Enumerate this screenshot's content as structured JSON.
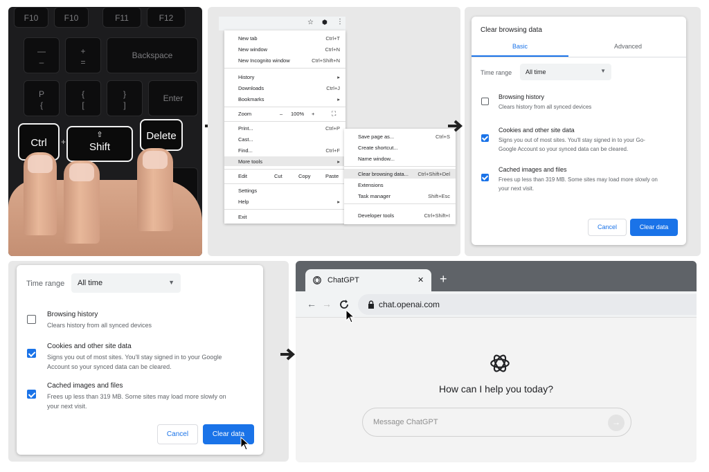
{
  "keyboard": {
    "f10a": "F10",
    "f10b": "F10",
    "f11": "F11",
    "f12": "F12",
    "minus_top": "—",
    "minus_bot": "–",
    "plus_top": "+",
    "plus_bot": "=",
    "backspace": "Backspace",
    "p_top": "P",
    "p_bot": "{",
    "bracket1_top": "{",
    "bracket1_bot": "[",
    "bracket2_top": "}",
    "bracket2_bot": "]",
    "enter": "Enter",
    "ctrl": "Ctrl",
    "shift": "Shift",
    "delete": "Delete",
    "plus_sign": "+"
  },
  "menu": {
    "items": [
      {
        "label": "New tab",
        "shortcut": "Ctrl+T"
      },
      {
        "label": "New window",
        "shortcut": "Ctrl+N"
      },
      {
        "label": "New Incognito window",
        "shortcut": "Ctrl+Shift+N"
      },
      {
        "label": "History",
        "shortcut": "▸"
      },
      {
        "label": "Downloads",
        "shortcut": "Ctrl+J"
      },
      {
        "label": "Bookmarks",
        "shortcut": "▸"
      },
      {
        "label": "Print...",
        "shortcut": "Ctrl+P"
      },
      {
        "label": "Cast...",
        "shortcut": ""
      },
      {
        "label": "Find...",
        "shortcut": "Ctrl+F"
      },
      {
        "label": "More tools",
        "shortcut": "▸"
      },
      {
        "label": "Settings",
        "shortcut": ""
      },
      {
        "label": "Help",
        "shortcut": "▸"
      },
      {
        "label": "Exit",
        "shortcut": ""
      }
    ],
    "zoom_label": "Zoom",
    "zoom_minus": "–",
    "zoom_value": "100%",
    "zoom_plus": "+",
    "zoom_fullscreen": "⛶",
    "edit_label": "Edit",
    "cut": "Cut",
    "copy": "Copy",
    "paste": "Paste"
  },
  "submenu": {
    "items": [
      {
        "label": "Save page as...",
        "shortcut": "Ctrl+S"
      },
      {
        "label": "Create shortcut...",
        "shortcut": ""
      },
      {
        "label": "Name window...",
        "shortcut": ""
      },
      {
        "label": "Clear browsing data...",
        "shortcut": "Ctrl+Shift+Del"
      },
      {
        "label": "Extensions",
        "shortcut": ""
      },
      {
        "label": "Task manager",
        "shortcut": "Shift+Esc"
      },
      {
        "label": "Developer tools",
        "shortcut": "Ctrl+Shift+I"
      }
    ]
  },
  "dialog1": {
    "title": "Clear browsing data",
    "tab_basic": "Basic",
    "tab_advanced": "Advanced",
    "time_range_label": "Time range",
    "time_range_value": "All time",
    "opt1_title": "Browsing history",
    "opt1_desc": "Clears history from all synced devices",
    "opt2_title": "Cookies and other site data",
    "opt2_desc_line1": "Signs you out of most sites. You'll stay signed in to your Go-",
    "opt2_desc_line2": "Google Account so your synced data can be cleared.",
    "opt3_title": "Cached images and files",
    "opt3_desc_line1": "Frees up less than 319 MB. Some sites may load more slowly on",
    "opt3_desc_line2": "your next visit.",
    "cancel": "Cancel",
    "clear": "Clear data"
  },
  "dialog2": {
    "time_range_label": "Time range",
    "time_range_value": "All time",
    "opt1_title": "Browsing history",
    "opt1_desc": "Clears history from all synced devices",
    "opt2_title": "Cookies and other site data",
    "opt2_desc_line1": "Signs you out of most sites. You'll stay signed in to your Google",
    "opt2_desc_line2": "Account so your synced data can be cleared.",
    "opt3_title": "Cached images and files",
    "opt3_desc_line1": "Frees up less than 319 MB. Some sites may load more slowly on",
    "opt3_desc_line2": "your next visit.",
    "cancel": "Cancel",
    "clear": "Clear data"
  },
  "browser": {
    "tab_title": "ChatGPT",
    "tab_close": "✕",
    "new_tab": "+",
    "back": "←",
    "forward": "→",
    "url": "chat.openai.com",
    "heading": "How can I help you today?",
    "placeholder": "Message ChatGPT"
  },
  "colors": {
    "accent": "#1a73e8",
    "panel_gray": "#e8e8e8",
    "arrow": "#222222"
  }
}
